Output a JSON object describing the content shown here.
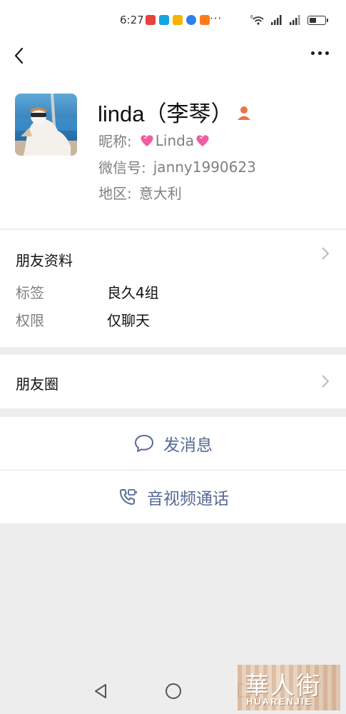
{
  "status_bar": {
    "time": "6:27",
    "more_indicator": "···",
    "network_badge": "6",
    "battery_level": 0.45,
    "notification_icons": [
      "news-app-icon",
      "message-app-icon",
      "mail-app-icon",
      "browser-app-icon",
      "shop-app-icon"
    ]
  },
  "profile": {
    "name": "linda（李琴）",
    "nickname_label": "昵称:",
    "nickname_value": "Linda",
    "wechat_id_label": "微信号:",
    "wechat_id_value": "janny1990623",
    "region_label": "地区:",
    "region_value": "意大利"
  },
  "friend_info": {
    "title": "朋友资料",
    "tag_label": "标签",
    "tag_value": "良久4组",
    "permission_label": "权限",
    "permission_value": "仅聊天"
  },
  "moments": {
    "title": "朋友圈"
  },
  "actions": {
    "message_label": "发消息",
    "call_label": "音视频通话"
  },
  "watermark": {
    "chinese": "華人街",
    "english": "HUARENJIE"
  },
  "colors": {
    "link_blue": "#576b95",
    "person_badge": "#e8744c",
    "heart_pink": "#f25ca2",
    "background_gray": "#ededed"
  }
}
